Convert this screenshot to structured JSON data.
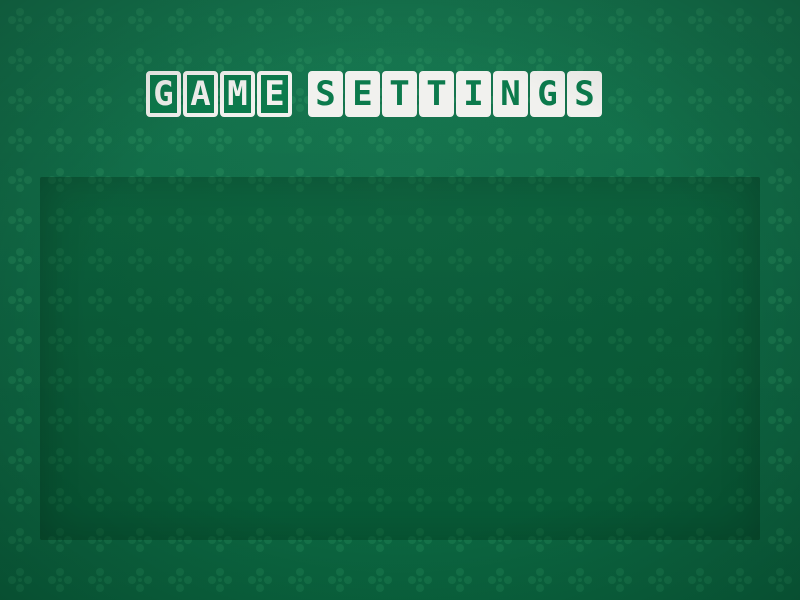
{
  "title": {
    "word1": [
      "G",
      "A",
      "M",
      "E"
    ],
    "word2": [
      "S",
      "E",
      "T",
      "T",
      "I",
      "N",
      "G",
      "S"
    ]
  },
  "colors": {
    "background": "#0b6b43",
    "pattern": "#2c9b62",
    "panel": "#0a5d37",
    "tile_text": "#f1f1ee",
    "tile_fill": "#0c7a4c"
  },
  "icons": {
    "background_pattern": "flower-pattern-icon"
  }
}
